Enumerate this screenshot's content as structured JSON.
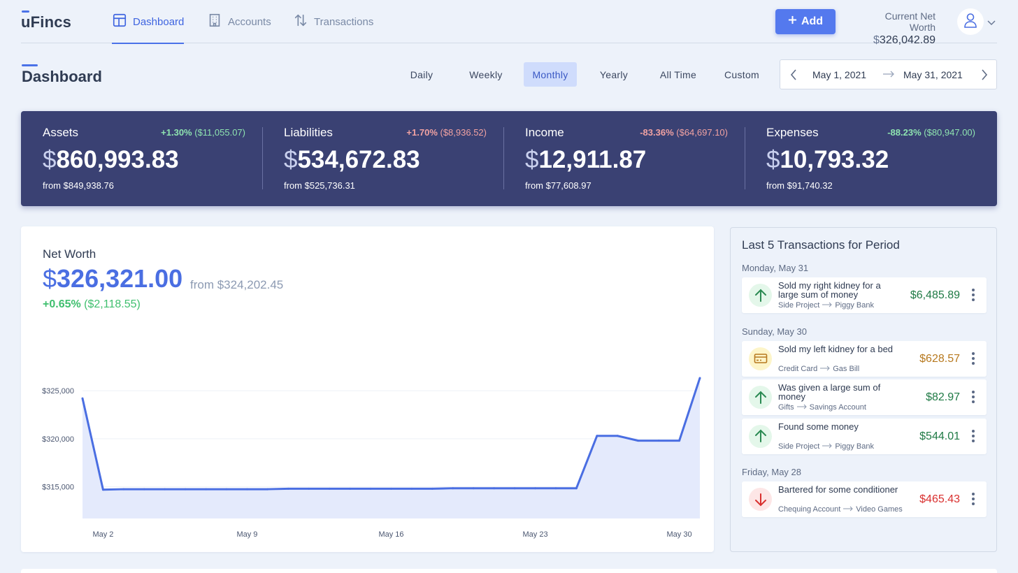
{
  "app": {
    "logo": "uFincs"
  },
  "nav": {
    "tabs": [
      {
        "label": "Dashboard",
        "icon": "dashboard-icon",
        "active": true
      },
      {
        "label": "Accounts",
        "icon": "building-icon",
        "active": false
      },
      {
        "label": "Transactions",
        "icon": "arrows-up-down-icon",
        "active": false
      }
    ],
    "add_label": "Add",
    "net_worth_label": "Current Net Worth",
    "net_worth_currency": "$",
    "net_worth_value": "326,042.89"
  },
  "header": {
    "title": "Dashboard",
    "periods": [
      "Daily",
      "Weekly",
      "Monthly",
      "Yearly",
      "All Time",
      "Custom"
    ],
    "active_period": "Monthly",
    "start_date": "May 1, 2021",
    "end_date": "May 31, 2021"
  },
  "summary": [
    {
      "name": "Assets",
      "pct": "+1.30%",
      "diff": "($11,055.07)",
      "tone": "pos",
      "currency": "$",
      "amount": "860,993.83",
      "from": "from $849,938.76"
    },
    {
      "name": "Liabilities",
      "pct": "+1.70%",
      "diff": "($8,936.52)",
      "tone": "neg",
      "currency": "$",
      "amount": "534,672.83",
      "from": "from $525,736.31"
    },
    {
      "name": "Income",
      "pct": "-83.36%",
      "diff": "($64,697.10)",
      "tone": "neg",
      "currency": "$",
      "amount": "12,911.87",
      "from": "from $77,608.97"
    },
    {
      "name": "Expenses",
      "pct": "-88.23%",
      "diff": "($80,947.00)",
      "tone": "pos",
      "currency": "$",
      "amount": "10,793.32",
      "from": "from $91,740.32"
    }
  ],
  "net_worth": {
    "title": "Net Worth",
    "currency": "$",
    "value": "326,321.00",
    "from": "from $324,202.45",
    "pct": "+0.65%",
    "diff": "($2,118.55)"
  },
  "chart_data": {
    "type": "area",
    "x": [
      "May 1",
      "May 2",
      "May 3",
      "May 4",
      "May 5",
      "May 6",
      "May 7",
      "May 8",
      "May 9",
      "May 10",
      "May 11",
      "May 12",
      "May 13",
      "May 14",
      "May 15",
      "May 16",
      "May 17",
      "May 18",
      "May 19",
      "May 20",
      "May 21",
      "May 22",
      "May 23",
      "May 24",
      "May 25",
      "May 26",
      "May 27",
      "May 28",
      "May 29",
      "May 30",
      "May 31"
    ],
    "values": [
      324200,
      314700,
      314750,
      314750,
      314750,
      314750,
      314750,
      314750,
      314750,
      314750,
      314800,
      314800,
      314800,
      314800,
      314800,
      314800,
      314800,
      314800,
      314850,
      314850,
      314850,
      314850,
      314850,
      314850,
      314850,
      320300,
      320300,
      319800,
      319800,
      319800,
      326321
    ],
    "xticks": [
      "May 2",
      "May 9",
      "May 16",
      "May 23",
      "May 30"
    ],
    "yticks": [
      {
        "value": 325000,
        "label": "$325,000"
      },
      {
        "value": 320000,
        "label": "$320,000"
      },
      {
        "value": 315000,
        "label": "$315,000"
      }
    ],
    "ylim": [
      311700,
      327700
    ],
    "line_color": "#4a6ee2",
    "fill_color": "#e4eafc"
  },
  "transactions": {
    "title": "Last 5 Transactions for Period",
    "days": [
      {
        "label": "Monday, May 31",
        "items": [
          {
            "description": "Sold my right kidney for a large sum of money",
            "from": "Side Project",
            "to": "Piggy Bank",
            "amount": "$6,485.89",
            "kind": "income"
          }
        ]
      },
      {
        "label": "Sunday, May 30",
        "items": [
          {
            "description": "Sold my left kidney for a bed",
            "from": "Credit Card",
            "to": "Gas Bill",
            "amount": "$628.57",
            "kind": "debt"
          },
          {
            "description": "Was given a large sum of money",
            "from": "Gifts",
            "to": "Savings Account",
            "amount": "$82.97",
            "kind": "income"
          },
          {
            "description": "Found some money",
            "from": "Side Project",
            "to": "Piggy Bank",
            "amount": "$544.01",
            "kind": "income"
          }
        ]
      },
      {
        "label": "Friday, May 28",
        "items": [
          {
            "description": "Bartered for some conditioner",
            "from": "Chequing Account",
            "to": "Video Games",
            "amount": "$465.43",
            "kind": "expense"
          }
        ]
      }
    ]
  },
  "colors": {
    "accent": "#4a6ee2",
    "summary_bg": "#3a4173",
    "positive": "#3fbf6e",
    "negative": "#d9302f",
    "debt": "#b7791f"
  }
}
